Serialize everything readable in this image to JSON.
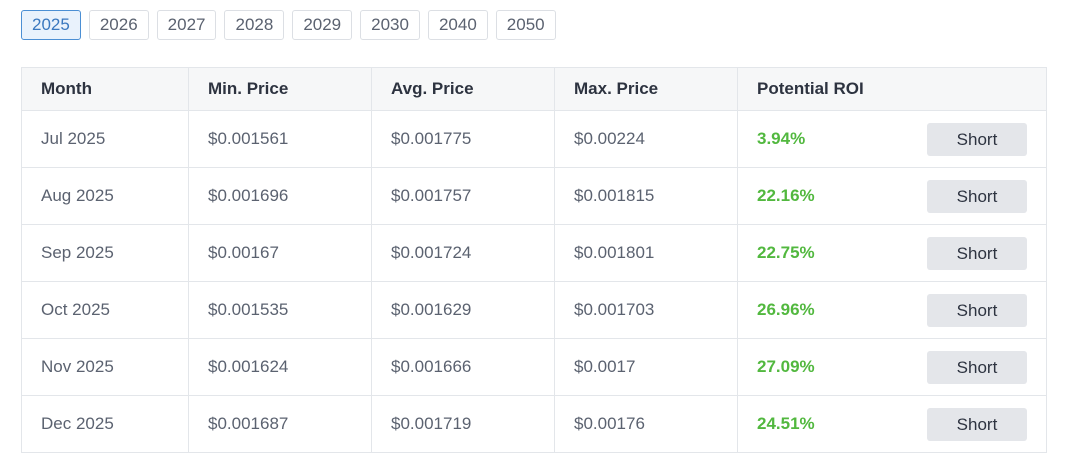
{
  "year_tabs": [
    "2025",
    "2026",
    "2027",
    "2028",
    "2029",
    "2030",
    "2040",
    "2050"
  ],
  "active_year": "2025",
  "table": {
    "headers": {
      "month": "Month",
      "min": "Min. Price",
      "avg": "Avg. Price",
      "max": "Max. Price",
      "roi": "Potential ROI"
    },
    "rows": [
      {
        "month": "Jul 2025",
        "min": "$0.001561",
        "avg": "$0.001775",
        "max": "$0.00224",
        "roi": "3.94%",
        "action": "Short"
      },
      {
        "month": "Aug 2025",
        "min": "$0.001696",
        "avg": "$0.001757",
        "max": "$0.001815",
        "roi": "22.16%",
        "action": "Short"
      },
      {
        "month": "Sep 2025",
        "min": "$0.00167",
        "avg": "$0.001724",
        "max": "$0.001801",
        "roi": "22.75%",
        "action": "Short"
      },
      {
        "month": "Oct 2025",
        "min": "$0.001535",
        "avg": "$0.001629",
        "max": "$0.001703",
        "roi": "26.96%",
        "action": "Short"
      },
      {
        "month": "Nov 2025",
        "min": "$0.001624",
        "avg": "$0.001666",
        "max": "$0.0017",
        "roi": "27.09%",
        "action": "Short"
      },
      {
        "month": "Dec 2025",
        "min": "$0.001687",
        "avg": "$0.001719",
        "max": "$0.00176",
        "roi": "24.51%",
        "action": "Short"
      }
    ]
  },
  "colors": {
    "roi_positive": "#52b83f",
    "active_tab_border": "#4b8fd4",
    "active_tab_bg": "#e9f2fc"
  }
}
